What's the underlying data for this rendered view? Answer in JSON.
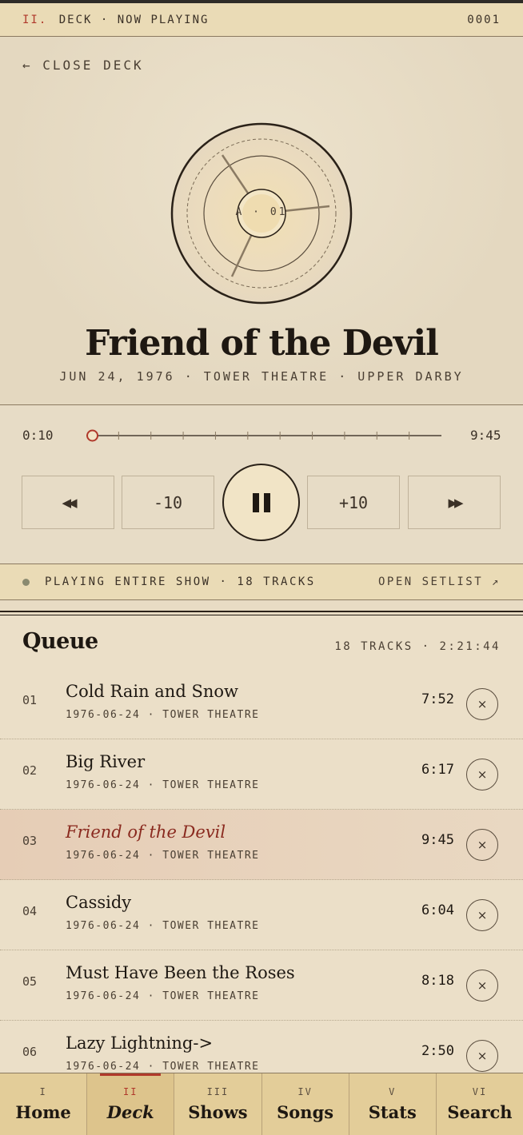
{
  "header": {
    "roman": "II.",
    "section": "DECK · NOW PLAYING",
    "counter": "0001"
  },
  "deck": {
    "close_label": "← CLOSE DECK",
    "record_label": "A · 01"
  },
  "now_playing": {
    "title": "Friend of the Devil",
    "meta": "JUN 24, 1976 · TOWER THEATRE · UPPER DARBY",
    "elapsed": "0:10",
    "duration": "9:45",
    "progress_fraction": 0.017
  },
  "controls": {
    "prev_icon": "◀◀",
    "back10_label": "-10",
    "play_state": "pause",
    "fwd10_label": "+10",
    "next_icon": "▶▶"
  },
  "status": {
    "text": "PLAYING ENTIRE SHOW · 18 TRACKS",
    "open_label": "OPEN SETLIST ↗"
  },
  "queue": {
    "title": "Queue",
    "summary": "18 TRACKS · 2:21:44",
    "items": [
      {
        "num": "01",
        "title": "Cold Rain and Snow",
        "sub": "1976-06-24 · TOWER THEATRE",
        "duration": "7:52",
        "remove": "×"
      },
      {
        "num": "02",
        "title": "Big River",
        "sub": "1976-06-24 · TOWER THEATRE",
        "duration": "6:17",
        "remove": "×"
      },
      {
        "num": "03",
        "title": "Friend of the Devil",
        "sub": "1976-06-24 · TOWER THEATRE",
        "duration": "9:45",
        "remove": "×"
      },
      {
        "num": "04",
        "title": "Cassidy",
        "sub": "1976-06-24 · TOWER THEATRE",
        "duration": "6:04",
        "remove": "×"
      },
      {
        "num": "05",
        "title": "Must Have Been the Roses",
        "sub": "1976-06-24 · TOWER THEATRE",
        "duration": "8:18",
        "remove": "×"
      },
      {
        "num": "06",
        "title": "Lazy Lightning->",
        "sub": "1976-06-24 · TOWER THEATRE",
        "duration": "2:50",
        "remove": "×"
      }
    ]
  },
  "tabs": [
    {
      "num": "I",
      "label": "Home"
    },
    {
      "num": "II",
      "label": "Deck"
    },
    {
      "num": "III",
      "label": "Shows"
    },
    {
      "num": "IV",
      "label": "Songs"
    },
    {
      "num": "V",
      "label": "Stats"
    },
    {
      "num": "VI",
      "label": "Search"
    }
  ],
  "colors": {
    "accent": "#b0392b",
    "background": "#e8dcc4",
    "tabbar": "#e3cd99"
  }
}
